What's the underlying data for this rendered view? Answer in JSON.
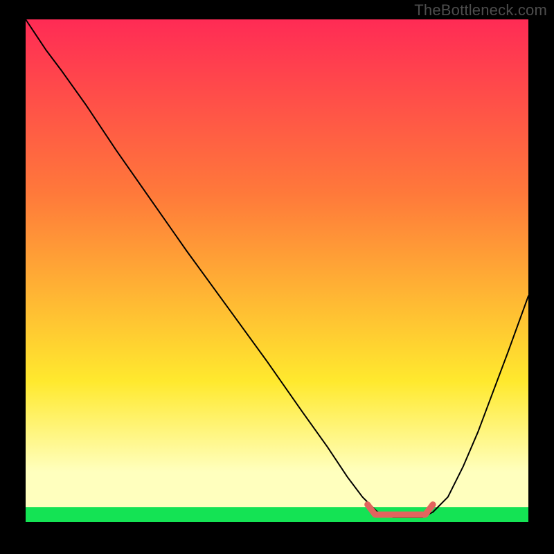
{
  "watermark": "TheBottleneck.com",
  "colors": {
    "background": "#000000",
    "watermark": "#4d4d4d",
    "gradient_top": "#ff2b55",
    "gradient_mid1": "#ff7a3a",
    "gradient_mid2": "#ffe92e",
    "gradient_band": "#ffffbe",
    "gradient_bottom": "#14e354",
    "curve": "#000000",
    "marker": "#e2645e"
  },
  "chart_data": {
    "type": "line",
    "title": "",
    "xlabel": "",
    "ylabel": "",
    "xlim": [
      0,
      100
    ],
    "ylim": [
      0,
      100
    ],
    "x": [
      0,
      4,
      7,
      12,
      18,
      25,
      32,
      40,
      48,
      55,
      60,
      64,
      67,
      70,
      73,
      76,
      79,
      81,
      84,
      87,
      90,
      93,
      96,
      100
    ],
    "y": [
      100,
      94,
      90,
      83,
      74,
      64,
      54,
      43,
      32,
      22,
      15,
      9,
      5,
      2,
      1,
      1,
      1,
      2,
      5,
      11,
      18,
      26,
      34,
      45
    ],
    "marker_segment": {
      "x_start": 68,
      "x_end": 81,
      "y": 1.5
    },
    "green_band_y": 3,
    "pale_band_y": 10
  }
}
